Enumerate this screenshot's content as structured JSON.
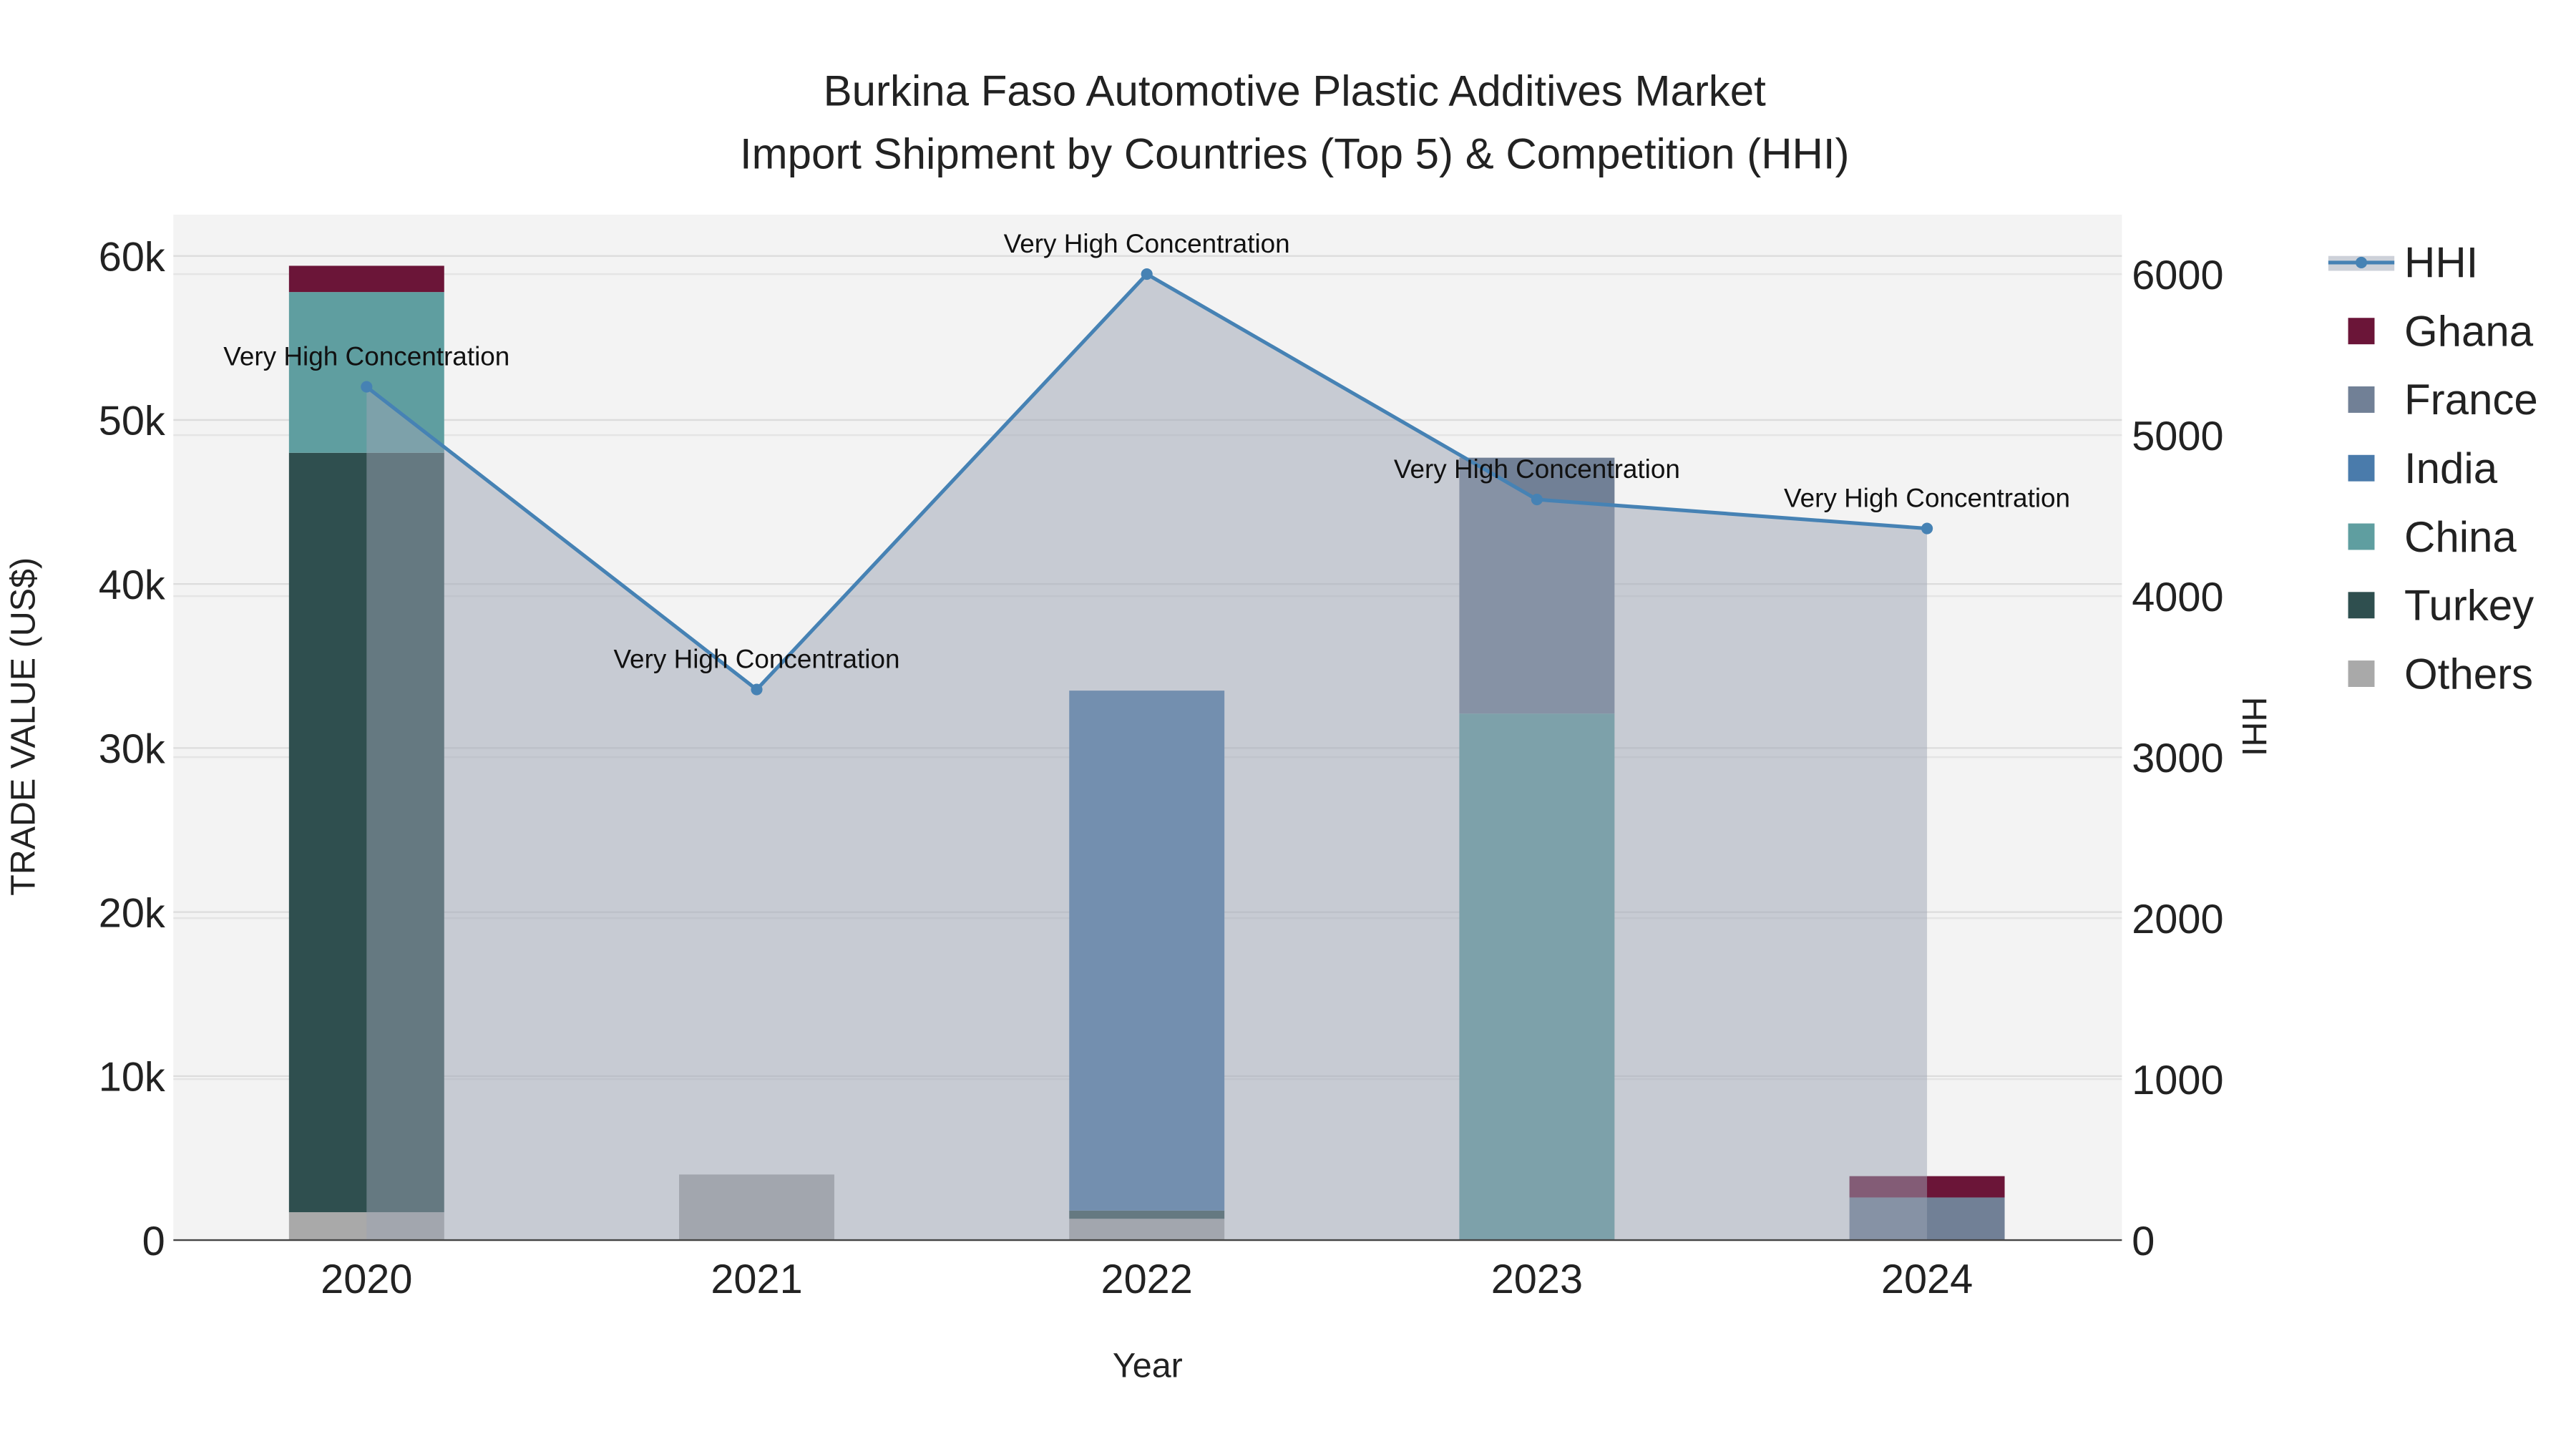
{
  "chart_data": {
    "type": "bar",
    "stacked": true,
    "title_line1": "Burkina Faso Automotive Plastic Additives Market",
    "title_line2": "Import Shipment by Countries (Top 5) & Competition (HHI)",
    "xlabel": "Year",
    "ylabel": "TRADE VALUE (US$)",
    "y2label": "HHI",
    "categories": [
      "2020",
      "2021",
      "2022",
      "2023",
      "2024"
    ],
    "ylim": [
      0,
      62000
    ],
    "y2lim": [
      0,
      6350
    ],
    "yticks": [
      0,
      10000,
      20000,
      30000,
      40000,
      50000,
      60000
    ],
    "ytick_labels": [
      "0",
      "10k",
      "20k",
      "30k",
      "40k",
      "50k",
      "60k"
    ],
    "y2ticks": [
      0,
      1000,
      2000,
      3000,
      4000,
      5000,
      6000
    ],
    "y2tick_labels": [
      "0",
      "1000",
      "2000",
      "3000",
      "4000",
      "5000",
      "6000"
    ],
    "grid": true,
    "legend_position": "right",
    "series": [
      {
        "name": "Others",
        "color": "#a9a9a9",
        "values": [
          1700,
          4000,
          1300,
          0,
          0
        ]
      },
      {
        "name": "Turkey",
        "color": "#2f4f4f",
        "values": [
          46300,
          0,
          500,
          0,
          0
        ]
      },
      {
        "name": "China",
        "color": "#5f9ea0",
        "values": [
          9800,
          0,
          0,
          32100,
          0
        ]
      },
      {
        "name": "India",
        "color": "#4a7bab",
        "values": [
          0,
          0,
          31700,
          0,
          0
        ]
      },
      {
        "name": "France",
        "color": "#718096",
        "values": [
          0,
          0,
          0,
          15600,
          2600
        ]
      },
      {
        "name": "Ghana",
        "color": "#6b1538",
        "values": [
          1600,
          0,
          0,
          0,
          1300
        ]
      }
    ],
    "hhi": {
      "name": "HHI",
      "color": "#4682b4",
      "values": [
        5300,
        3420,
        6000,
        4600,
        4420
      ],
      "annotations": [
        "Very High Concentration",
        "Very High Concentration",
        "Very High Concentration",
        "Very High Concentration",
        "Very High Concentration"
      ]
    },
    "legend_order": [
      "HHI",
      "Ghana",
      "France",
      "India",
      "China",
      "Turkey",
      "Others"
    ]
  }
}
